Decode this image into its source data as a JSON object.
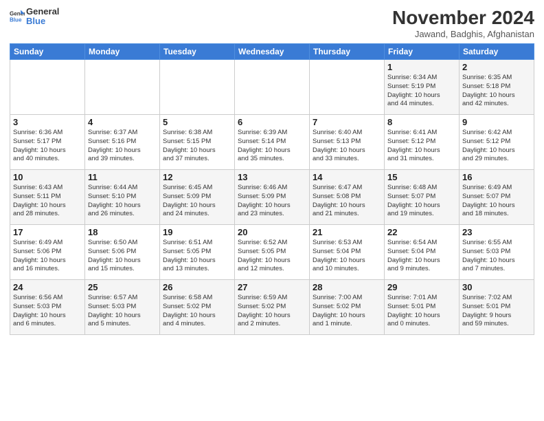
{
  "header": {
    "logo_general": "General",
    "logo_blue": "Blue",
    "month_year": "November 2024",
    "location": "Jawand, Badghis, Afghanistan"
  },
  "days_of_week": [
    "Sunday",
    "Monday",
    "Tuesday",
    "Wednesday",
    "Thursday",
    "Friday",
    "Saturday"
  ],
  "weeks": [
    [
      {
        "day": "",
        "info": ""
      },
      {
        "day": "",
        "info": ""
      },
      {
        "day": "",
        "info": ""
      },
      {
        "day": "",
        "info": ""
      },
      {
        "day": "",
        "info": ""
      },
      {
        "day": "1",
        "info": "Sunrise: 6:34 AM\nSunset: 5:19 PM\nDaylight: 10 hours\nand 44 minutes."
      },
      {
        "day": "2",
        "info": "Sunrise: 6:35 AM\nSunset: 5:18 PM\nDaylight: 10 hours\nand 42 minutes."
      }
    ],
    [
      {
        "day": "3",
        "info": "Sunrise: 6:36 AM\nSunset: 5:17 PM\nDaylight: 10 hours\nand 40 minutes."
      },
      {
        "day": "4",
        "info": "Sunrise: 6:37 AM\nSunset: 5:16 PM\nDaylight: 10 hours\nand 39 minutes."
      },
      {
        "day": "5",
        "info": "Sunrise: 6:38 AM\nSunset: 5:15 PM\nDaylight: 10 hours\nand 37 minutes."
      },
      {
        "day": "6",
        "info": "Sunrise: 6:39 AM\nSunset: 5:14 PM\nDaylight: 10 hours\nand 35 minutes."
      },
      {
        "day": "7",
        "info": "Sunrise: 6:40 AM\nSunset: 5:13 PM\nDaylight: 10 hours\nand 33 minutes."
      },
      {
        "day": "8",
        "info": "Sunrise: 6:41 AM\nSunset: 5:12 PM\nDaylight: 10 hours\nand 31 minutes."
      },
      {
        "day": "9",
        "info": "Sunrise: 6:42 AM\nSunset: 5:12 PM\nDaylight: 10 hours\nand 29 minutes."
      }
    ],
    [
      {
        "day": "10",
        "info": "Sunrise: 6:43 AM\nSunset: 5:11 PM\nDaylight: 10 hours\nand 28 minutes."
      },
      {
        "day": "11",
        "info": "Sunrise: 6:44 AM\nSunset: 5:10 PM\nDaylight: 10 hours\nand 26 minutes."
      },
      {
        "day": "12",
        "info": "Sunrise: 6:45 AM\nSunset: 5:09 PM\nDaylight: 10 hours\nand 24 minutes."
      },
      {
        "day": "13",
        "info": "Sunrise: 6:46 AM\nSunset: 5:09 PM\nDaylight: 10 hours\nand 23 minutes."
      },
      {
        "day": "14",
        "info": "Sunrise: 6:47 AM\nSunset: 5:08 PM\nDaylight: 10 hours\nand 21 minutes."
      },
      {
        "day": "15",
        "info": "Sunrise: 6:48 AM\nSunset: 5:07 PM\nDaylight: 10 hours\nand 19 minutes."
      },
      {
        "day": "16",
        "info": "Sunrise: 6:49 AM\nSunset: 5:07 PM\nDaylight: 10 hours\nand 18 minutes."
      }
    ],
    [
      {
        "day": "17",
        "info": "Sunrise: 6:49 AM\nSunset: 5:06 PM\nDaylight: 10 hours\nand 16 minutes."
      },
      {
        "day": "18",
        "info": "Sunrise: 6:50 AM\nSunset: 5:06 PM\nDaylight: 10 hours\nand 15 minutes."
      },
      {
        "day": "19",
        "info": "Sunrise: 6:51 AM\nSunset: 5:05 PM\nDaylight: 10 hours\nand 13 minutes."
      },
      {
        "day": "20",
        "info": "Sunrise: 6:52 AM\nSunset: 5:05 PM\nDaylight: 10 hours\nand 12 minutes."
      },
      {
        "day": "21",
        "info": "Sunrise: 6:53 AM\nSunset: 5:04 PM\nDaylight: 10 hours\nand 10 minutes."
      },
      {
        "day": "22",
        "info": "Sunrise: 6:54 AM\nSunset: 5:04 PM\nDaylight: 10 hours\nand 9 minutes."
      },
      {
        "day": "23",
        "info": "Sunrise: 6:55 AM\nSunset: 5:03 PM\nDaylight: 10 hours\nand 7 minutes."
      }
    ],
    [
      {
        "day": "24",
        "info": "Sunrise: 6:56 AM\nSunset: 5:03 PM\nDaylight: 10 hours\nand 6 minutes."
      },
      {
        "day": "25",
        "info": "Sunrise: 6:57 AM\nSunset: 5:03 PM\nDaylight: 10 hours\nand 5 minutes."
      },
      {
        "day": "26",
        "info": "Sunrise: 6:58 AM\nSunset: 5:02 PM\nDaylight: 10 hours\nand 4 minutes."
      },
      {
        "day": "27",
        "info": "Sunrise: 6:59 AM\nSunset: 5:02 PM\nDaylight: 10 hours\nand 2 minutes."
      },
      {
        "day": "28",
        "info": "Sunrise: 7:00 AM\nSunset: 5:02 PM\nDaylight: 10 hours\nand 1 minute."
      },
      {
        "day": "29",
        "info": "Sunrise: 7:01 AM\nSunset: 5:01 PM\nDaylight: 10 hours\nand 0 minutes."
      },
      {
        "day": "30",
        "info": "Sunrise: 7:02 AM\nSunset: 5:01 PM\nDaylight: 9 hours\nand 59 minutes."
      }
    ]
  ]
}
